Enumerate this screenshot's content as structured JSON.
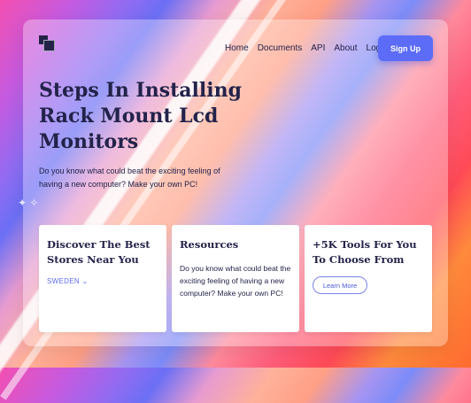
{
  "nav": {
    "links": [
      "Home",
      "Documents",
      "API",
      "About",
      "Log in"
    ],
    "signup_label": "Sign Up"
  },
  "hero": {
    "title": "Steps In Installing Rack Mount Lcd Monitors",
    "subtitle": "Do you know what could beat the exciting feeling of having a new computer? Make your own PC!"
  },
  "cards": [
    {
      "title": "Discover The Best Stores Near You",
      "dropdown_value": "SWEDEN"
    },
    {
      "title": "Resources",
      "text": "Do you know what could beat the exciting feeling of having a new computer? Make your own PC!"
    },
    {
      "title": "+5K Tools For You To Choose From",
      "button_label": "Learn More"
    }
  ],
  "icons": {
    "logo": "logo-icon",
    "dropdown": "chevron-down-icon"
  },
  "colors": {
    "accent": "#5c6cf7",
    "text": "#23234a"
  }
}
